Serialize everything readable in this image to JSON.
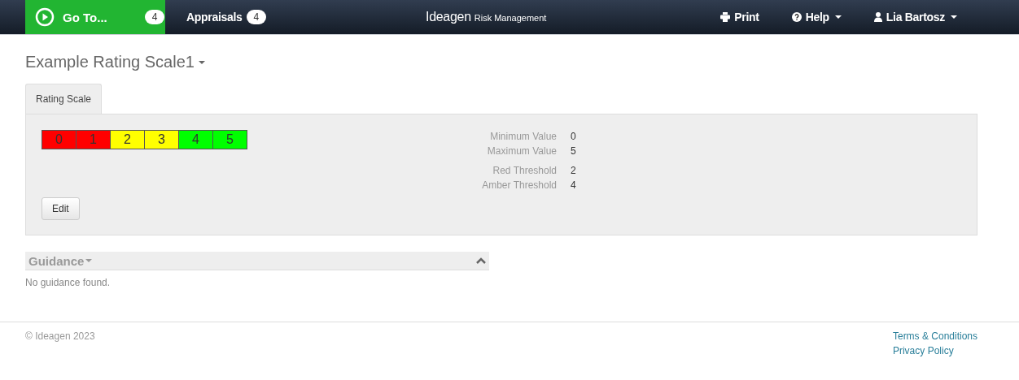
{
  "navbar": {
    "goto": {
      "label": "Go To...",
      "count": "4"
    },
    "appraisals": {
      "label": "Appraisals",
      "count": "4"
    },
    "logo": {
      "brand": "Ideagen",
      "product": "Risk Management"
    },
    "print": "Print",
    "help": "Help",
    "user": "Lia Bartosz"
  },
  "title": "Example Rating Scale1",
  "tabs": [
    {
      "label": "Rating Scale",
      "selected": true
    }
  ],
  "scale": [
    {
      "label": "0",
      "color": "#ff0000"
    },
    {
      "label": "1",
      "color": "#ff0000"
    },
    {
      "label": "2",
      "color": "#ffff00"
    },
    {
      "label": "3",
      "color": "#ffff00"
    },
    {
      "label": "4",
      "color": "#00ff00"
    },
    {
      "label": "5",
      "color": "#00ff00"
    }
  ],
  "details": [
    [
      {
        "label": "Minimum Value",
        "value": "0"
      },
      {
        "label": "Maximum Value",
        "value": "5"
      }
    ],
    [
      {
        "label": "Red Threshold",
        "value": "2"
      },
      {
        "label": "Amber Threshold",
        "value": "4"
      }
    ]
  ],
  "edit_button": "Edit",
  "guidance": {
    "title": "Guidance",
    "expanded": true,
    "empty_text": "No guidance found."
  },
  "footer": {
    "copyright": "© Ideagen 2023",
    "links": [
      "Terms & Conditions",
      "Privacy Policy"
    ]
  }
}
